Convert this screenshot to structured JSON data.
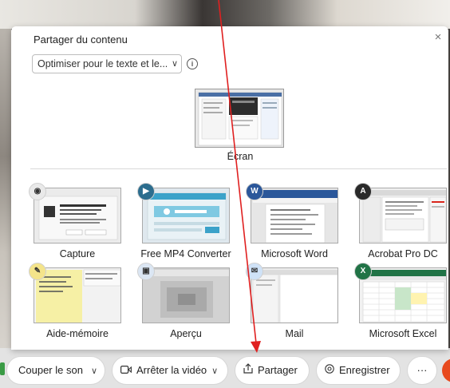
{
  "dialog": {
    "title": "Partager du contenu",
    "close": "×",
    "optimize": "Optimiser pour le texte et le...",
    "optimize_chevron": "∨",
    "info": "i"
  },
  "screen": {
    "label": "Écran"
  },
  "apps": [
    {
      "label": "Capture",
      "icon": "camera-icon",
      "icon_text": "◉"
    },
    {
      "label": "Free MP4 Converter",
      "icon": "video-converter-icon",
      "icon_text": "▶"
    },
    {
      "label": "Microsoft Word",
      "icon": "word-icon",
      "icon_text": "W"
    },
    {
      "label": "Acrobat Pro DC",
      "icon": "acrobat-icon",
      "icon_text": "A"
    },
    {
      "label": "Aide-mémoire",
      "icon": "stickies-icon",
      "icon_text": "✎"
    },
    {
      "label": "Aperçu",
      "icon": "preview-icon",
      "icon_text": "▣"
    },
    {
      "label": "Mail",
      "icon": "mail-icon",
      "icon_text": "✉"
    },
    {
      "label": "Microsoft Excel",
      "icon": "excel-icon",
      "icon_text": "X"
    }
  ],
  "toolbar": {
    "mute": "Couper le son",
    "stop_video": "Arrêter la vidéo",
    "share": "Partager",
    "record": "Enregistrer",
    "more": "···",
    "chevron": "∨"
  },
  "colors": {
    "accent_red_arrow": "#e02020",
    "end_call": "#e84a1e",
    "word_blue": "#2b579a",
    "excel_green": "#217346",
    "acrobat_red": "#d9261c"
  }
}
